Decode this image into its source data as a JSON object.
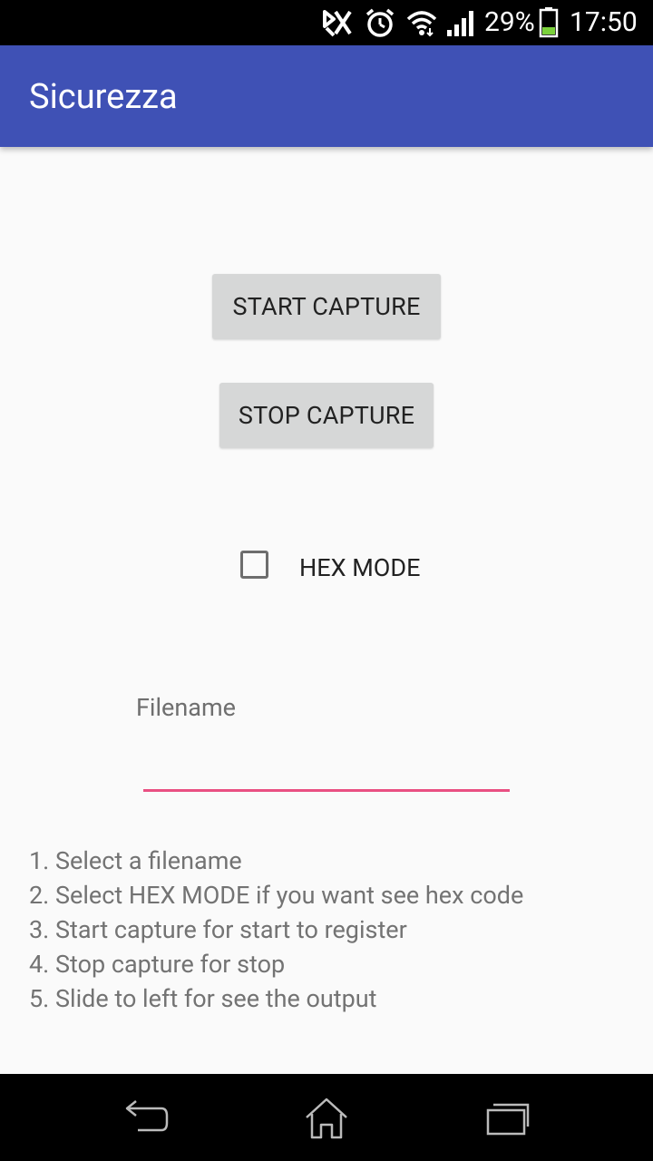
{
  "status_bar": {
    "icons": [
      "nfc-icon",
      "alarm-icon",
      "wifi-icon",
      "signal-icon",
      "battery-icon"
    ],
    "battery": "29%",
    "time": "17:50"
  },
  "app_bar": {
    "title": "Sicurezza"
  },
  "buttons": {
    "start_capture": "START CAPTURE",
    "stop_capture": "STOP CAPTURE"
  },
  "hex_mode": {
    "label": "HEX MODE",
    "checked": false
  },
  "filename": {
    "hint": "Filename",
    "value": ""
  },
  "instructions": [
    "1. Select a filename",
    "2. Select HEX MODE if you want see hex code",
    "3. Start capture for start to register",
    "4. Stop capture for stop",
    "5. Slide to left for see the output"
  ],
  "nav_bar": {
    "icons": [
      "back-icon",
      "home-icon",
      "recents-icon"
    ]
  },
  "colors": {
    "app_bar": "#3f51b5",
    "accent": "#e94f82",
    "button": "#d6d7d7",
    "background": "#fafafa"
  }
}
